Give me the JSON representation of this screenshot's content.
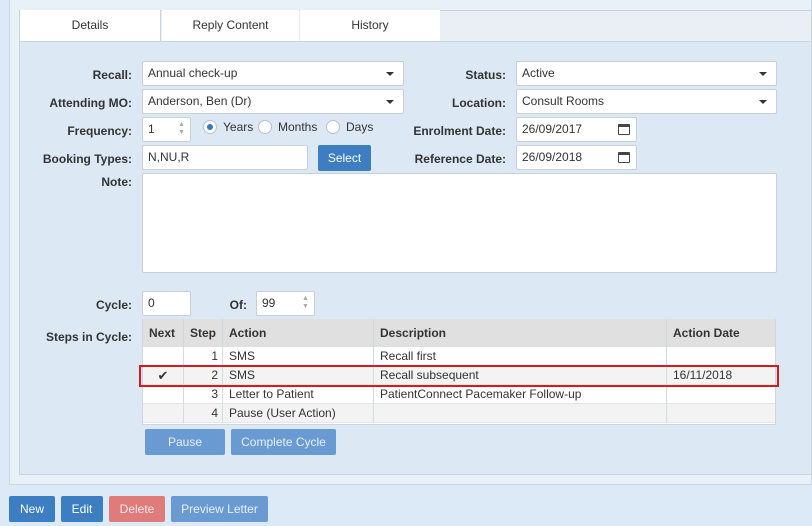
{
  "tabs": [
    "Details",
    "Reply Content",
    "History"
  ],
  "form": {
    "recall_label": "Recall:",
    "recall_value": "Annual check-up",
    "attending_label": "Attending MO:",
    "attending_value": "Anderson, Ben (Dr)",
    "frequency_label": "Frequency:",
    "frequency_value": "1",
    "freq_years": "Years",
    "freq_months": "Months",
    "freq_days": "Days",
    "frequency_selected": "Years",
    "booking_label": "Booking Types:",
    "booking_value": "N,NU,R",
    "select_button": "Select",
    "note_label": "Note:",
    "note_value": "",
    "status_label": "Status:",
    "status_value": "Active",
    "location_label": "Location:",
    "location_value": "Consult Rooms",
    "enrolment_label": "Enrolment Date:",
    "enrolment_value": "26/09/2017",
    "reference_label": "Reference Date:",
    "reference_value": "26/09/2018",
    "cycle_label": "Cycle:",
    "cycle_value": "0",
    "of_label": "Of:",
    "of_value": "99",
    "steps_label": "Steps in Cycle:"
  },
  "steps_table": {
    "headers": {
      "next": "Next",
      "step": "Step",
      "action": "Action",
      "description": "Description",
      "action_date": "Action Date"
    },
    "rows": [
      {
        "next": "",
        "step": "1",
        "action": "SMS",
        "description": "Recall first",
        "action_date": ""
      },
      {
        "next": "✔",
        "step": "2",
        "action": "SMS",
        "description": "Recall subsequent",
        "action_date": "16/11/2018"
      },
      {
        "next": "",
        "step": "3",
        "action": "Letter to Patient",
        "description": "PatientConnect Pacemaker Follow-up",
        "action_date": ""
      },
      {
        "next": "",
        "step": "4",
        "action": "Pause (User Action)",
        "description": "",
        "action_date": ""
      }
    ],
    "highlight_color": "#d9191f"
  },
  "cycle_buttons": {
    "pause": "Pause",
    "complete": "Complete Cycle"
  },
  "footer": {
    "new": "New",
    "edit": "Edit",
    "delete": "Delete",
    "preview": "Preview Letter"
  }
}
